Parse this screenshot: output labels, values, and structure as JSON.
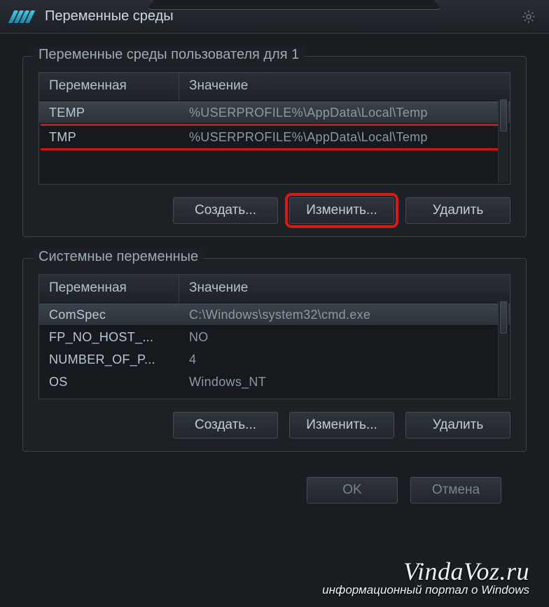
{
  "window": {
    "title": "Переменные среды"
  },
  "user_group": {
    "label": "Переменные среды пользователя для 1",
    "header_var": "Переменная",
    "header_val": "Значение",
    "rows": [
      {
        "name": "TEMP",
        "value": "%USERPROFILE%\\AppData\\Local\\Temp",
        "selected": true
      },
      {
        "name": "TMP",
        "value": "%USERPROFILE%\\AppData\\Local\\Temp",
        "selected": false
      }
    ],
    "btn_create": "Создать...",
    "btn_edit": "Изменить...",
    "btn_delete": "Удалить"
  },
  "system_group": {
    "label": "Системные переменные",
    "header_var": "Переменная",
    "header_val": "Значение",
    "rows": [
      {
        "name": "ComSpec",
        "value": "C:\\Windows\\system32\\cmd.exe",
        "selected": true
      },
      {
        "name": "FP_NO_HOST_...",
        "value": "NO",
        "selected": false
      },
      {
        "name": "NUMBER_OF_P...",
        "value": "4",
        "selected": false
      },
      {
        "name": "OS",
        "value": "Windows_NT",
        "selected": false
      }
    ],
    "btn_create": "Создать...",
    "btn_edit": "Изменить...",
    "btn_delete": "Удалить"
  },
  "dialog": {
    "ok": "OK",
    "cancel": "Отмена"
  },
  "watermark": {
    "site": "VindaVoz.ru",
    "tagline": "информационный портал о Windows"
  }
}
